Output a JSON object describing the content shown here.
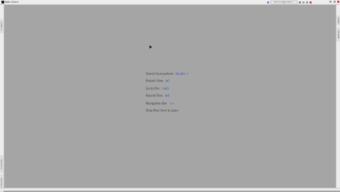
{
  "window": {
    "title": "Web Client"
  },
  "toolbar": {
    "run_config_label": "Add Configuration..."
  },
  "sidebar_left": {
    "tabs": [
      {
        "label": "1: Project"
      },
      {
        "label": "2: Favorites"
      },
      {
        "label": "7: Structure"
      }
    ]
  },
  "sidebar_right": {
    "tabs": [
      {
        "label": "Gradle"
      },
      {
        "label": "Ant Build"
      }
    ]
  },
  "empty_state": {
    "hints": [
      {
        "label": "Search Everywhere",
        "shortcut": "Double ⇧"
      },
      {
        "label": "Project View",
        "shortcut": "⌘1"
      },
      {
        "label": "Go to File",
        "shortcut": "⇧⌘O"
      },
      {
        "label": "Recent Files",
        "shortcut": "⌘E"
      },
      {
        "label": "Navigation Bar",
        "shortcut": "⌥↖"
      },
      {
        "label": "Drop files here to open",
        "shortcut": ""
      }
    ]
  }
}
